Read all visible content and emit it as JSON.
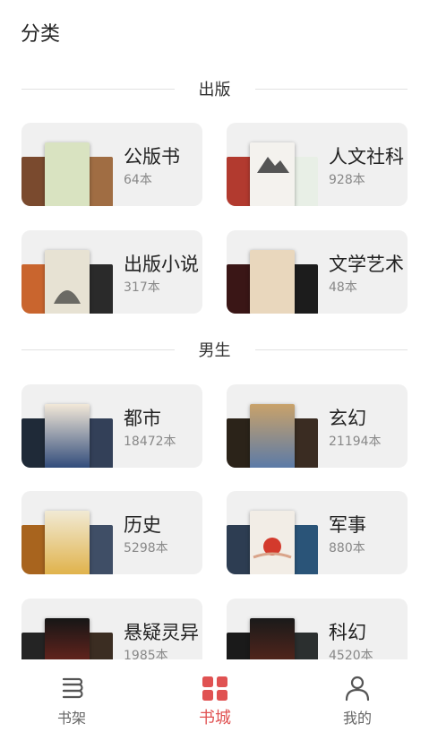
{
  "header": {
    "title": "分类"
  },
  "sections": [
    {
      "title": "出版",
      "items": [
        {
          "label": "公版书",
          "count": "64本",
          "covers": [
            "#7a4a2e",
            "#d9e3c1",
            "#a06d43"
          ]
        },
        {
          "label": "人文社科",
          "count": "928本",
          "covers": [
            "#b23a2f",
            "#f4f2ee",
            "#e8efe6"
          ]
        },
        {
          "label": "出版小说",
          "count": "317本",
          "covers": [
            "#c9652e",
            "#e7e2d3",
            "#2a2a2a"
          ]
        },
        {
          "label": "文学艺术",
          "count": "48本",
          "covers": [
            "#3a1616",
            "#e9d7bd",
            "#1c1c1c"
          ]
        }
      ]
    },
    {
      "title": "男生",
      "items": [
        {
          "label": "都市",
          "count": "18472本",
          "covers": [
            "#1f2a38",
            "#2f4a7a",
            "#334058"
          ]
        },
        {
          "label": "玄幻",
          "count": "21194本",
          "covers": [
            "#2b2319",
            "#5a7aa8",
            "#3a2c22"
          ]
        },
        {
          "label": "历史",
          "count": "5298本",
          "covers": [
            "#a8641e",
            "#f1ead4",
            "#3f4e66"
          ]
        },
        {
          "label": "军事",
          "count": "880本",
          "covers": [
            "#2d3d52",
            "#f2ede6",
            "#2a5478"
          ]
        },
        {
          "label": "悬疑灵异",
          "count": "1985本",
          "covers": [
            "#242424",
            "#161616",
            "#3b2d22"
          ]
        },
        {
          "label": "科幻",
          "count": "4520本",
          "covers": [
            "#1a1a1a",
            "#6e2a1c",
            "#2b2f2f"
          ]
        }
      ]
    }
  ],
  "tabs": [
    {
      "label": "书架",
      "icon": "bookshelf-icon",
      "active": false
    },
    {
      "label": "书城",
      "icon": "bookstore-grid-icon",
      "active": true
    },
    {
      "label": "我的",
      "icon": "profile-icon",
      "active": false
    }
  ],
  "colors": {
    "accent": "#e05252",
    "card_bg": "#f0f0f0",
    "muted": "#888888"
  }
}
